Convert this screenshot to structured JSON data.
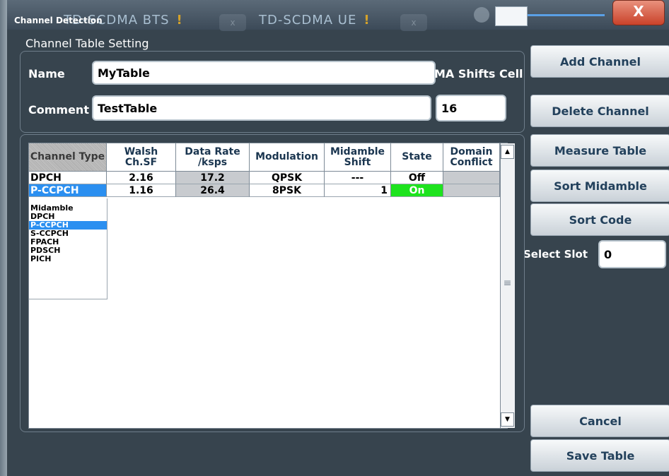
{
  "window": {
    "title": "Channel Detection",
    "tabs": [
      {
        "label": "TD-SCDMA BTS",
        "warning": "!"
      },
      {
        "label": "TD-SCDMA UE",
        "warning": "!"
      }
    ],
    "close_label": "X"
  },
  "setting": {
    "section_label": "Channel Table Setting",
    "name_label": "Name",
    "name_value": "MyTable",
    "comment_label": "Comment",
    "comment_value": "TestTable",
    "ma_label": "MA Shifts Cell",
    "ma_value": "16"
  },
  "table": {
    "headers": [
      "Channel Type",
      "Walsh Ch.SF",
      "Data Rate /ksps",
      "Modulation",
      "Midamble Shift",
      "State",
      "Domain Conflict"
    ],
    "rows": [
      {
        "type": "DPCH",
        "walsh": "2.16",
        "rate": "17.2",
        "modulation": "QPSK",
        "midamble": "---",
        "state": "Off",
        "conflict": ""
      },
      {
        "type": "P-CCPCH",
        "walsh": "1.16",
        "rate": "26.4",
        "modulation": "8PSK",
        "midamble": "1",
        "state": "On",
        "conflict": ""
      }
    ],
    "dropdown_options": [
      "Midamble",
      "DPCH",
      "P-CCPCH",
      "S-CCPCH",
      "FPACH",
      "PDSCH",
      "PICH"
    ],
    "dropdown_selected": "P-CCPCH"
  },
  "buttons": {
    "add_channel": "Add Channel",
    "delete_channel": "Delete Channel",
    "measure_table": "Measure Table",
    "sort_midamble": "Sort Midamble",
    "sort_code": "Sort Code",
    "cancel": "Cancel",
    "save_table": "Save Table"
  },
  "slot": {
    "label": "Select Slot",
    "value": "0"
  },
  "colors": {
    "selected": "#2b8ff0",
    "state_on": "#1ee31e",
    "close": "#c9422a"
  }
}
